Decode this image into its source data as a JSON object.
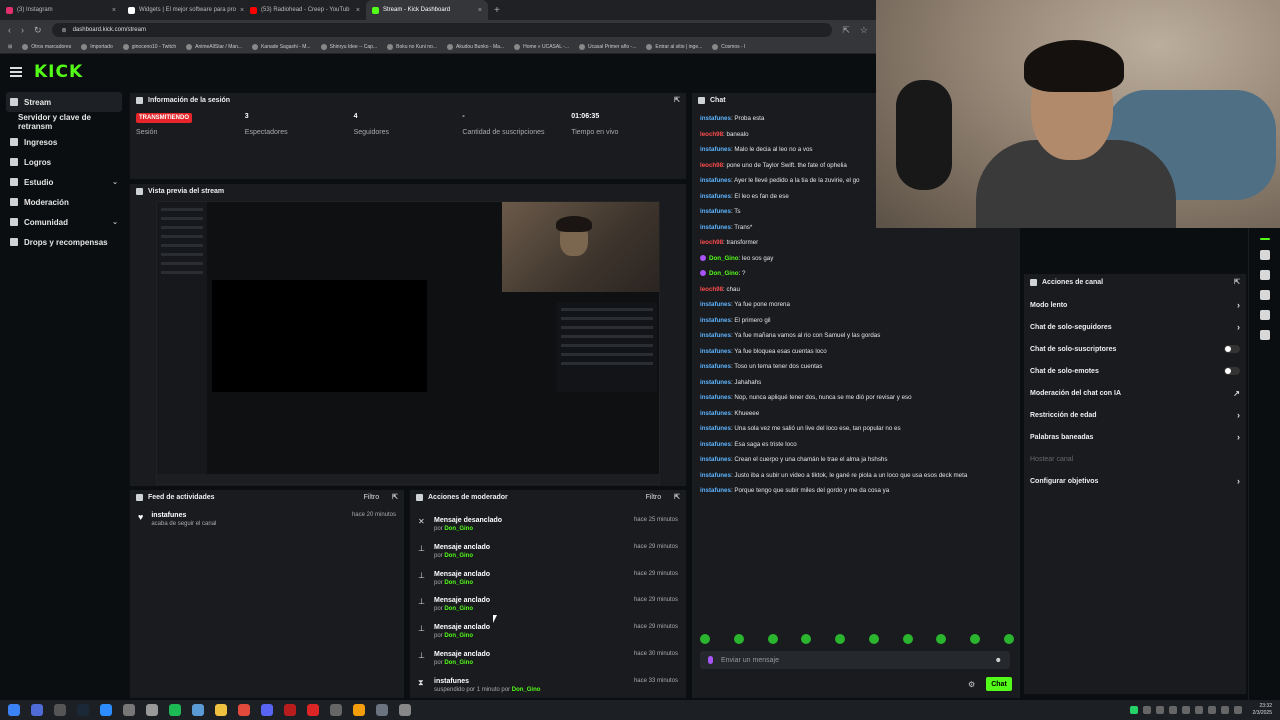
{
  "browser": {
    "tabs": [
      {
        "label": "(3) Instagram",
        "color": "#e1306c"
      },
      {
        "label": "Widgets | El mejor software para pro",
        "color": "#ffffff"
      },
      {
        "label": "(53) Radiohead - Creep - YouTub",
        "color": "#ff0000"
      },
      {
        "label": "Stream - Kick Dashboard",
        "color": "#53fc18"
      }
    ],
    "url": "dashboard.kick.com/stream",
    "bookmarks": [
      "Otros marcadores",
      "Importado",
      "ginoceno10 - Twitch",
      "AnimeAllStar / Man...",
      "Kanade Sagashi - M...",
      "Shinryu Idee -- Cap...",
      "Boku no Kuni no...",
      "Akudou Bunko - Ma...",
      "Home « UCASAL -...",
      "Ucasal Primer año -...",
      "Entrar al sitio | inge...",
      "Cosmos - I"
    ]
  },
  "app": {
    "logo": "KICK"
  },
  "sidebar": {
    "items": [
      {
        "label": "Stream",
        "icon": "broadcast-icon",
        "active": true
      },
      {
        "label": "Servidor y clave de retransm",
        "icon": "",
        "sub": true
      },
      {
        "label": "Ingresos",
        "icon": "wallet-icon"
      },
      {
        "label": "Logros",
        "icon": "trophy-icon"
      },
      {
        "label": "Estudio",
        "icon": "studio-icon",
        "chevron": true
      },
      {
        "label": "Moderación",
        "icon": "shield-icon"
      },
      {
        "label": "Comunidad",
        "icon": "community-icon",
        "chevron": true
      },
      {
        "label": "Drops y recompensas",
        "icon": "gift-icon"
      }
    ]
  },
  "session": {
    "title": "Información de la sesión",
    "badge": "TRANSMITIENDO",
    "stats": [
      {
        "value": "",
        "label": "Sesión"
      },
      {
        "value": "3",
        "label": "Espectadores"
      },
      {
        "value": "4",
        "label": "Seguidores"
      },
      {
        "value": "-",
        "label": "Cantidad de suscripciones"
      },
      {
        "value": "01:06:35",
        "label": "Tiempo en vivo"
      }
    ]
  },
  "preview": {
    "title": "Vista previa del stream"
  },
  "feed": {
    "title": "Feed de actividades",
    "filter": "Filtro",
    "items": [
      {
        "user": "instafunes",
        "text": "acaba de seguir el canal",
        "time": "hace 20 minutos"
      }
    ]
  },
  "mod": {
    "title": "Acciones de moderador",
    "filter": "Filtro",
    "items": [
      {
        "title": "Mensaje desanclado",
        "prefix": "por",
        "by": "Don_Gino",
        "time": "hace 25 minutos",
        "icon": "unpin-icon"
      },
      {
        "title": "Mensaje anclado",
        "prefix": "por",
        "by": "Don_Gino",
        "time": "hace 29 minutos",
        "icon": "pin-icon"
      },
      {
        "title": "Mensaje anclado",
        "prefix": "por",
        "by": "Don_Gino",
        "time": "hace 29 minutos",
        "icon": "pin-icon"
      },
      {
        "title": "Mensaje anclado",
        "prefix": "por",
        "by": "Don_Gino",
        "time": "hace 29 minutos",
        "icon": "pin-icon"
      },
      {
        "title": "Mensaje anclado",
        "prefix": "por",
        "by": "Don_Gino",
        "time": "hace 29 minutos",
        "icon": "pin-icon"
      },
      {
        "title": "Mensaje anclado",
        "prefix": "por",
        "by": "Don_Gino",
        "time": "hace 30 minutos",
        "icon": "pin-icon"
      },
      {
        "title": "instafunes",
        "prefix": "suspendido por 1 minuto por",
        "by": "Don_Gino",
        "time": "hace 33 minutos",
        "icon": "timeout-icon"
      }
    ]
  },
  "chat": {
    "title": "Chat",
    "placeholder": "Enviar un mensaje",
    "send": "Chat",
    "messages": [
      {
        "user": "instafunes",
        "color": "#5eb4ff",
        "text": "Proba esta"
      },
      {
        "user": "leoch98",
        "color": "#ff4d4d",
        "text": "banealo"
      },
      {
        "user": "instafunes",
        "color": "#5eb4ff",
        "text": "Malo le decia al leo no a vos"
      },
      {
        "user": "leoch98",
        "color": "#ff4d4d",
        "text": "pone uno de Taylor Swift. the fate of ophelia"
      },
      {
        "user": "instafunes",
        "color": "#5eb4ff",
        "text": "Ayer le llevé pedido a la tia de la zuvirie, el go"
      },
      {
        "user": "instafunes",
        "color": "#5eb4ff",
        "text": "El leo es fan de ese"
      },
      {
        "user": "instafunes",
        "color": "#5eb4ff",
        "text": "Ts"
      },
      {
        "user": "instafunes",
        "color": "#5eb4ff",
        "text": "Trans*"
      },
      {
        "user": "leoch98",
        "color": "#ff4d4d",
        "text": "transformer"
      },
      {
        "user": "Don_Gino",
        "color": "#53fc18",
        "text": "leo sos gay",
        "badge": true
      },
      {
        "user": "Don_Gino",
        "color": "#53fc18",
        "text": "?",
        "badge": true
      },
      {
        "user": "leoch98",
        "color": "#ff4d4d",
        "text": "chau"
      },
      {
        "user": "instafunes",
        "color": "#5eb4ff",
        "text": "Ya fue pone morena"
      },
      {
        "user": "instafunes",
        "color": "#5eb4ff",
        "text": "El primero gil"
      },
      {
        "user": "instafunes",
        "color": "#5eb4ff",
        "text": "Ya fue mañana vamos al rio con Samuel y las gordas"
      },
      {
        "user": "instafunes",
        "color": "#5eb4ff",
        "text": "Ya fue bloquea esas cuentas loco"
      },
      {
        "user": "instafunes",
        "color": "#5eb4ff",
        "text": "Toso un tema tener dos cuentas"
      },
      {
        "user": "instafunes",
        "color": "#5eb4ff",
        "text": "Jahahahs"
      },
      {
        "user": "instafunes",
        "color": "#5eb4ff",
        "text": "Nop, nunca apliqué tener dos, nunca se me dió por revisar y eso"
      },
      {
        "user": "instafunes",
        "color": "#5eb4ff",
        "text": "Khueeee"
      },
      {
        "user": "instafunes",
        "color": "#5eb4ff",
        "text": "Una sola vez me salió un live del loco ese, tan popular no es"
      },
      {
        "user": "instafunes",
        "color": "#5eb4ff",
        "text": "Esa saga es triste loco"
      },
      {
        "user": "instafunes",
        "color": "#5eb4ff",
        "text": "Crean el cuerpo y una chamán le trae el alma ja hshshs"
      },
      {
        "user": "instafunes",
        "color": "#5eb4ff",
        "text": "Justo iba a subir un video a tiktok, le gané re piola a un loco que usa esos deck meta"
      },
      {
        "user": "instafunes",
        "color": "#5eb4ff",
        "text": "Porque tengo que subir miles del gordo y me da cosa ya"
      }
    ]
  },
  "channel_actions": {
    "title": "Acciones de canal",
    "items": [
      {
        "label": "Modo lento",
        "control": "arrow"
      },
      {
        "label": "Chat de solo-seguidores",
        "control": "arrow"
      },
      {
        "label": "Chat de solo-suscriptores",
        "control": "toggle"
      },
      {
        "label": "Chat de solo-emotes",
        "control": "toggle"
      },
      {
        "label": "Moderación del chat con IA",
        "control": "trend"
      },
      {
        "label": "Restricción de edad",
        "control": "arrow"
      },
      {
        "label": "Palabras baneadas",
        "control": "arrow"
      },
      {
        "label": "Hostear canal",
        "control": "none",
        "dim": true
      },
      {
        "label": "Configurar objetivos",
        "control": "arrow"
      }
    ]
  },
  "taskbar": {
    "time": "23:32",
    "date": "2/3/2025"
  }
}
